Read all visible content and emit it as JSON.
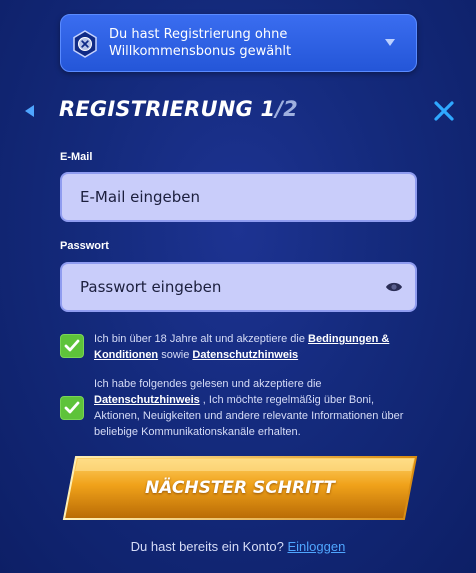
{
  "bonus": {
    "text": "Du hast Registrierung ohne Willkommensbonus gewählt",
    "icons": {
      "badge": "no-bonus-icon",
      "toggle": "chevron-down-icon"
    }
  },
  "header": {
    "title_main": "REGISTRIERUNG 1",
    "title_total": "/2",
    "icons": {
      "back": "back-arrow-icon",
      "close": "close-icon"
    }
  },
  "form": {
    "email": {
      "label": "E-Mail",
      "placeholder": "E-Mail eingeben"
    },
    "password": {
      "label": "Passwort",
      "placeholder": "Passwort eingeben",
      "icon": "eye-icon"
    }
  },
  "consents": [
    {
      "checked": true,
      "text_before": "Ich bin über 18 Jahre alt und akzeptiere die ",
      "link1": "Bedingungen & Konditionen",
      "text_middle": " sowie ",
      "link2": "Datenschutzhinweis"
    },
    {
      "checked": true,
      "text_before": "Ich habe folgendes gelesen und akzeptiere die ",
      "link1": "Datenschutzhinweis",
      "text_after": " , Ich möchte regelmäßig über Boni, Aktionen, Neuigkeiten und andere relevante Informationen über beliebige Kommunikationskanäle erhalten."
    }
  ],
  "cta": {
    "label": "NÄCHSTER SCHRITT"
  },
  "login": {
    "prompt": "Du hast bereits ein Konto?",
    "link": "Einloggen"
  },
  "colors": {
    "background": "#142a7c",
    "bonus_box": "#2a5ce0",
    "input_bg": "#c9cdfa",
    "checkbox": "#5ec33a",
    "cta_gold": "#e8a319",
    "link_blue": "#4fa6ff"
  }
}
